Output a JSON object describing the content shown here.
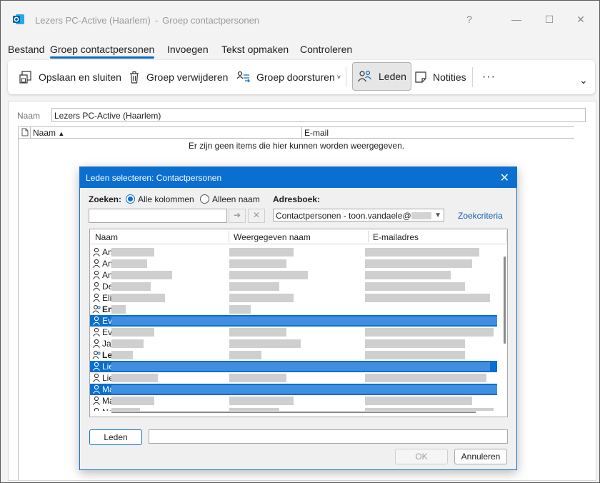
{
  "window": {
    "title": "Lezers PC-Active (Haarlem)",
    "separator": "-",
    "subtitle": "Groep contactpersonen",
    "help": "?",
    "minimize": "—",
    "maximize": "☐",
    "close": "✕"
  },
  "menu": {
    "tabs": [
      {
        "label": "Bestand"
      },
      {
        "label": "Groep contactpersonen"
      },
      {
        "label": "Invoegen"
      },
      {
        "label": "Tekst opmaken"
      },
      {
        "label": "Controleren"
      }
    ]
  },
  "ribbon": {
    "save_close": "Opslaan en sluiten",
    "delete_group": "Groep verwijderen",
    "forward_group": "Groep doorsturen",
    "members": "Leden",
    "notes": "Notities",
    "more": "···",
    "expand": "⌄"
  },
  "form": {
    "name_label": "Naam",
    "name_value": "Lezers PC-Active (Haarlem)",
    "col_name": "Naam",
    "col_email": "E-mail",
    "empty_message": "Er zijn geen items die hier kunnen worden weergegeven."
  },
  "dialog": {
    "title": "Leden selecteren: Contactpersonen",
    "close": "✕",
    "search_label": "Zoeken:",
    "option_all": "Alle kolommen",
    "option_name": "Alleen naam",
    "addressbook_label": "Adresboek:",
    "addressbook_value": "Contactpersonen - toon.vandaele@",
    "go": "➔",
    "clear": "✕",
    "advanced_link": "Zoekcriteria",
    "columns": {
      "name": "Naam",
      "display": "Weergegeven naam",
      "email": "E-mailadres"
    },
    "rows": [
      {
        "text": "An",
        "selected": false,
        "group": false
      },
      {
        "text": "An",
        "selected": false,
        "group": false
      },
      {
        "text": "An",
        "selected": false,
        "group": false
      },
      {
        "text": "De",
        "selected": false,
        "group": false
      },
      {
        "text": "Eli",
        "selected": false,
        "group": false
      },
      {
        "text": "En",
        "selected": false,
        "group": true
      },
      {
        "text": "Ev",
        "selected": true,
        "group": false
      },
      {
        "text": "Ev",
        "selected": false,
        "group": false
      },
      {
        "text": "Jac",
        "selected": false,
        "group": false
      },
      {
        "text": "Le",
        "selected": false,
        "group": true
      },
      {
        "text": "Lie",
        "selected": true,
        "group": false
      },
      {
        "text": "Lie",
        "selected": false,
        "group": false
      },
      {
        "text": "Ma",
        "selected": true,
        "group": false
      },
      {
        "text": "Ma",
        "selected": false,
        "group": false
      },
      {
        "text": "Ne",
        "selected": false,
        "group": false
      }
    ],
    "members_button": "Leden",
    "ok": "OK",
    "cancel": "Annuleren"
  },
  "colors": {
    "accent": "#0f6cbd",
    "dialog_title": "#0a6fd0",
    "selection": "#0a6fd0"
  }
}
